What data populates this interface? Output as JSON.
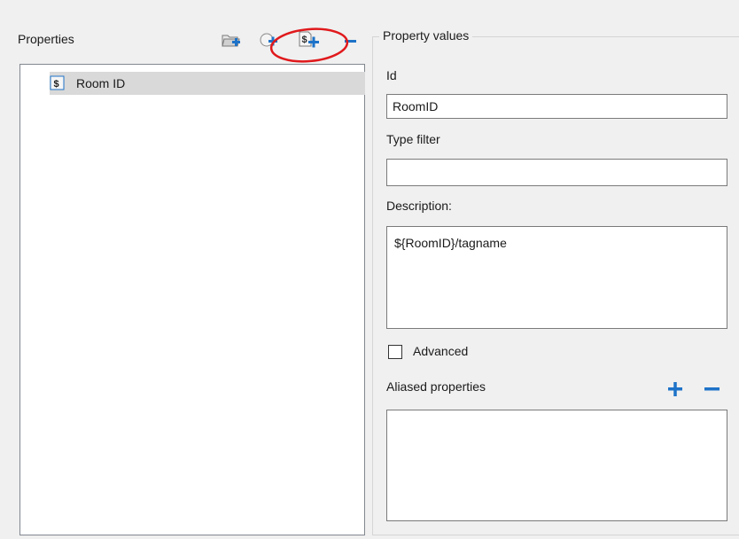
{
  "properties_panel": {
    "title": "Properties",
    "toolbar": [
      {
        "name": "add-folder-button",
        "icon": "folder-add-icon"
      },
      {
        "name": "add-property-button",
        "icon": "circle-add-icon"
      },
      {
        "name": "add-variable-property-button",
        "icon": "dollar-add-icon",
        "highlighted": true
      },
      {
        "name": "remove-property-button",
        "icon": "minus-icon"
      }
    ],
    "tree_items": [
      {
        "label": "Room ID",
        "icon": "dollar-icon",
        "selected": true
      }
    ]
  },
  "property_values": {
    "legend": "Property values",
    "id_label": "Id",
    "id_value": "RoomID",
    "type_filter_label": "Type filter",
    "type_filter_value": "",
    "description_label": "Description:",
    "description_value": "${RoomID}/tagname",
    "advanced_label": "Advanced",
    "advanced_checked": false,
    "aliased_properties_label": "Aliased properties",
    "aliased_properties": []
  },
  "colors": {
    "accent_blue": "#1e73c8",
    "highlight_red": "#e0191c",
    "selection": "#d9d9d9"
  }
}
